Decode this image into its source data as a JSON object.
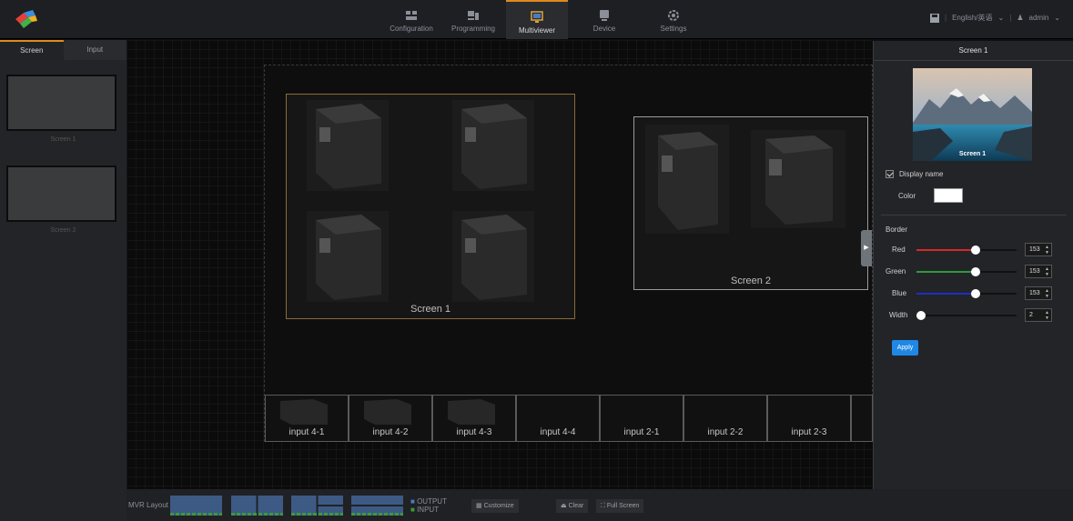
{
  "topbar": {
    "nav": [
      {
        "label": "Configuration",
        "icon": "configuration-icon"
      },
      {
        "label": "Programming",
        "icon": "programming-icon"
      },
      {
        "label": "Multiviewer",
        "icon": "multiviewer-icon"
      },
      {
        "label": "Device",
        "icon": "device-icon"
      },
      {
        "label": "Settings",
        "icon": "settings-icon"
      }
    ],
    "active_nav": "Multiviewer",
    "language": "English/英语",
    "user": "admin"
  },
  "left_panel": {
    "tabs": [
      {
        "label": "Screen"
      },
      {
        "label": "Input"
      }
    ],
    "screens": [
      {
        "label": "Screen 1"
      },
      {
        "label": "Screen 2"
      }
    ]
  },
  "canvas": {
    "screens": [
      {
        "label": "Screen 1"
      },
      {
        "label": "Screen 2"
      }
    ],
    "inputs": [
      {
        "label": "input 4-1"
      },
      {
        "label": "input 4-2"
      },
      {
        "label": "input 4-3"
      },
      {
        "label": "input 4-4"
      },
      {
        "label": "input 2-1"
      },
      {
        "label": "input 2-2"
      },
      {
        "label": "input 2-3"
      }
    ]
  },
  "bottom_bar": {
    "mvr_layout_label": "MVR Layout",
    "legend_output": "OUTPUT",
    "legend_input": "INPUT",
    "customize": "Customize",
    "clear": "Clear",
    "full_screen": "Full Screen"
  },
  "right_panel": {
    "title": "Screen 1",
    "preview_label": "Screen 1",
    "display_name_label": "Display name",
    "display_name_checked": true,
    "color_label": "Color",
    "color_value": "#ffffff",
    "border_label": "Border",
    "sliders": [
      {
        "label": "Red",
        "value": "153",
        "level": 0.6,
        "color": "#d62828"
      },
      {
        "label": "Green",
        "value": "153",
        "level": 0.6,
        "color": "#2e9b3a"
      },
      {
        "label": "Blue",
        "value": "153",
        "level": 0.6,
        "color": "#1c2fc2"
      },
      {
        "label": "Width",
        "value": "2",
        "level": 0.0,
        "color": "#ffffff"
      }
    ],
    "apply": "Apply"
  },
  "colors": {
    "accent": "#e08a1e",
    "apply_button": "#1f88e5",
    "border_selected": "#8a6a3a"
  }
}
